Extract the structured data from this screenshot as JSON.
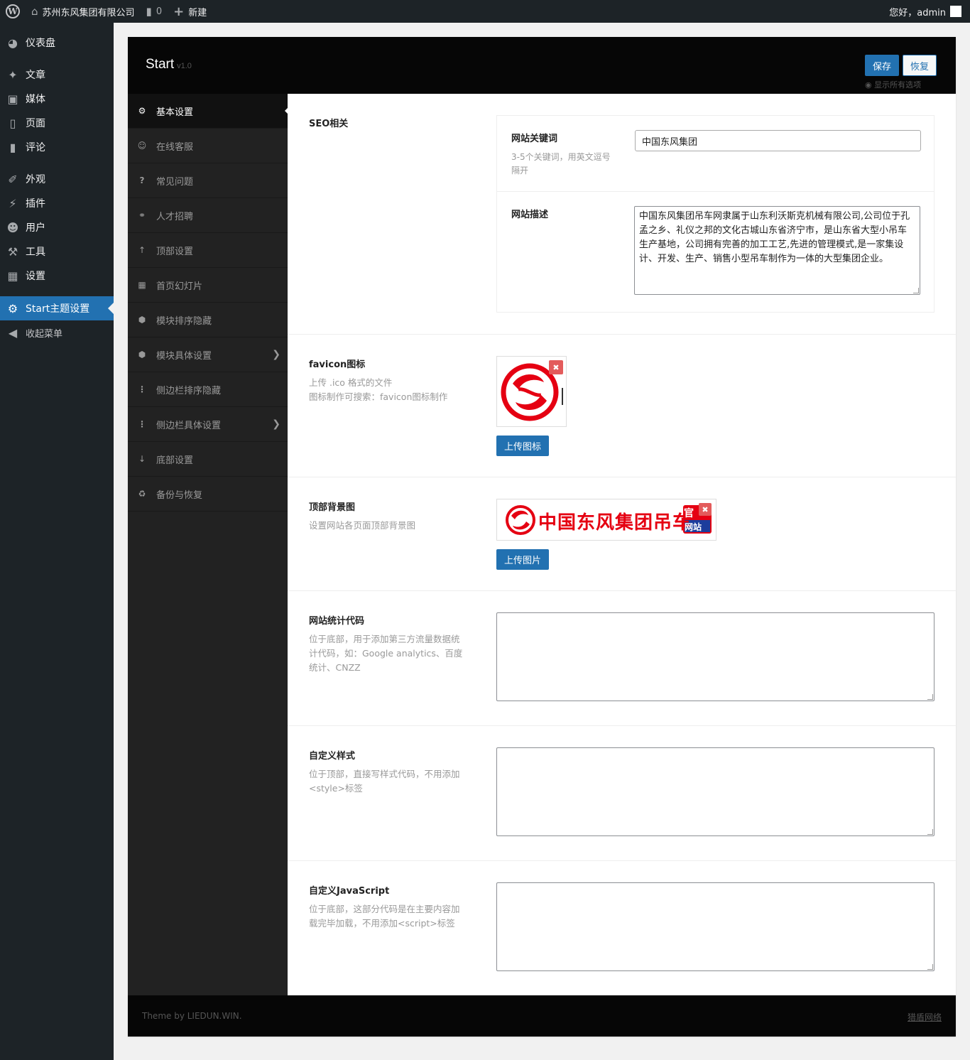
{
  "adminbar": {
    "site_name": "苏州东风集团有限公司",
    "comments_count": "0",
    "new_label": "新建",
    "greeting": "您好，admin"
  },
  "sidebar": {
    "items": [
      {
        "label": "仪表盘",
        "icon": "dashboard-icon"
      },
      {
        "label": "文章",
        "icon": "pin-icon"
      },
      {
        "label": "媒体",
        "icon": "media-icon"
      },
      {
        "label": "页面",
        "icon": "page-icon"
      },
      {
        "label": "评论",
        "icon": "comment-icon"
      },
      {
        "label": "外观",
        "icon": "appearance-icon"
      },
      {
        "label": "插件",
        "icon": "plugin-icon"
      },
      {
        "label": "用户",
        "icon": "user-icon"
      },
      {
        "label": "工具",
        "icon": "wrench-icon"
      },
      {
        "label": "设置",
        "icon": "settings-icon"
      },
      {
        "label": "Start主题设置",
        "icon": "gear-icon"
      },
      {
        "label": "收起菜单",
        "icon": "collapse-icon"
      }
    ]
  },
  "panel": {
    "title": "Start",
    "version": "v1.0",
    "save_label": "保存",
    "reset_label": "恢复",
    "show_all_label": "显示所有选项",
    "footer_left": "Theme by LIEDUN.WIN.",
    "footer_right": "猎盾网络"
  },
  "nav": {
    "items": [
      {
        "label": "基本设置"
      },
      {
        "label": "在线客服"
      },
      {
        "label": "常见问题"
      },
      {
        "label": "人才招聘"
      },
      {
        "label": "顶部设置"
      },
      {
        "label": "首页幻灯片"
      },
      {
        "label": "模块排序隐藏"
      },
      {
        "label": "模块具体设置"
      },
      {
        "label": "侧边栏排序隐藏"
      },
      {
        "label": "侧边栏具体设置"
      },
      {
        "label": "底部设置"
      },
      {
        "label": "备份与恢复"
      }
    ]
  },
  "seo": {
    "title": "SEO相关",
    "keywords_label": "网站关键词",
    "keywords_desc": "3-5个关键词，用英文逗号隔开",
    "keywords_value": "中国东风集团",
    "description_label": "网站描述",
    "description_value": "中国东风集团吊车网隶属于山东利沃斯克机械有限公司,公司位于孔孟之乡、礼仪之邦的文化古城山东省济宁市，是山东省大型小吊车生产基地，公司拥有完善的加工工艺,先进的管理模式,是一家集设计、开发、生产、销售小型吊车制作为一体的大型集团企业。"
  },
  "favicon": {
    "title": "favicon图标",
    "desc_line1": "上传 .ico 格式的文件",
    "desc_line2": "图标制作可搜索：favicon图标制作",
    "upload_label": "上传图标"
  },
  "header_bg": {
    "title": "顶部背景图",
    "desc": "设置网站各页面顶部背景图",
    "banner_text": "中国东风集团吊车",
    "badge_top": "官",
    "badge_bottom": "网站",
    "upload_label": "上传图片"
  },
  "stats": {
    "title": "网站统计代码",
    "desc": "位于底部，用于添加第三方流量数据统计代码，如：Google analytics、百度统计、CNZZ"
  },
  "custom_css": {
    "title": "自定义样式",
    "desc": "位于顶部，直接写样式代码，不用添加<style>标签"
  },
  "custom_js": {
    "title": "自定义JavaScript",
    "desc": "位于底部，这部分代码是在主要内容加载完毕加载，不用添加<script>标签"
  }
}
